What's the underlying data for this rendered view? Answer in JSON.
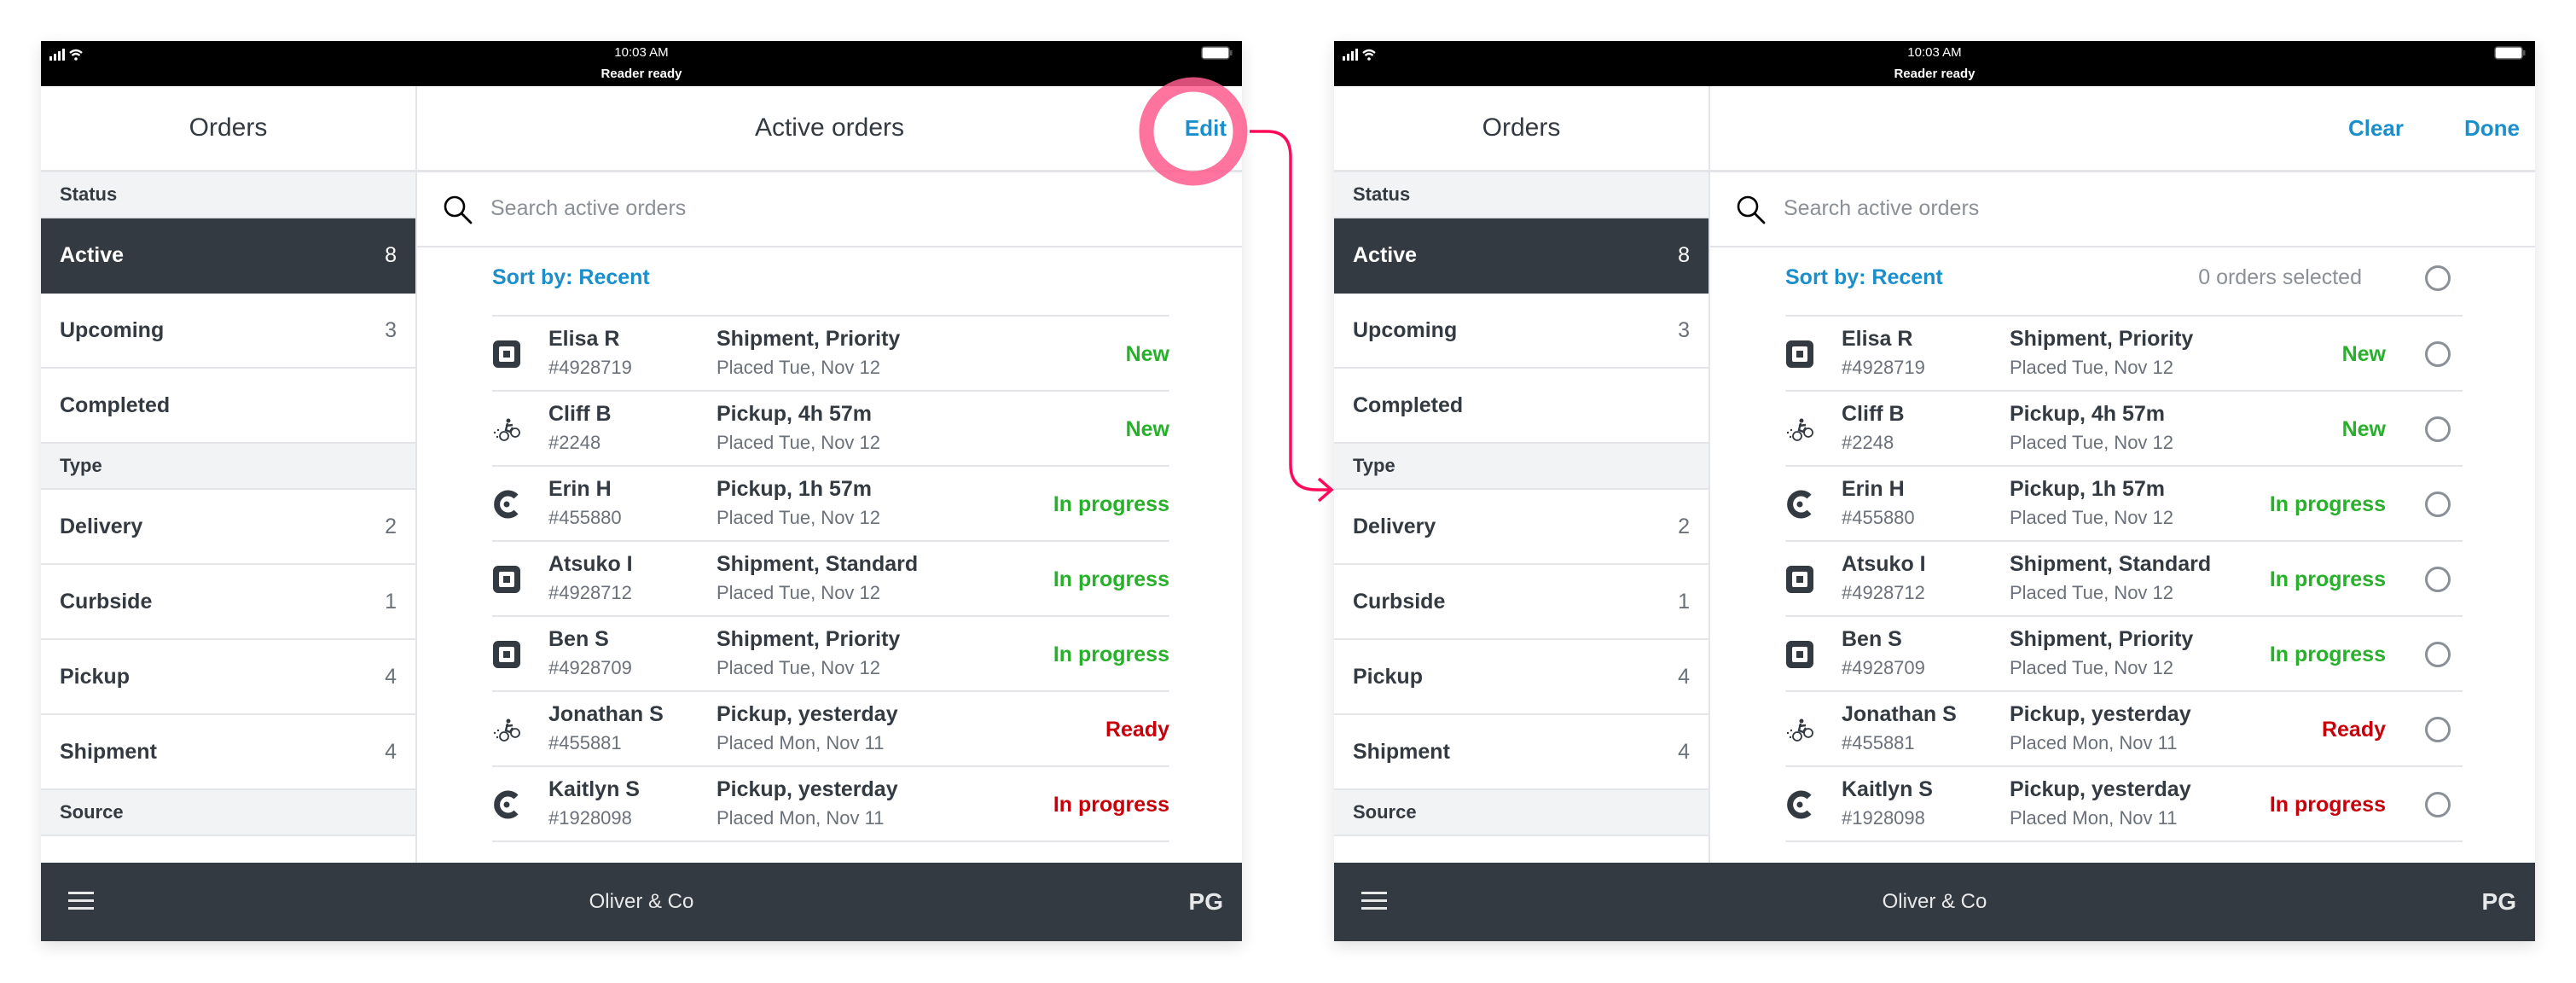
{
  "status_bar": {
    "time": "10:03 AM",
    "reader_status": "Reader ready"
  },
  "sidebar": {
    "title": "Orders",
    "sections": [
      {
        "header": "Status",
        "items": [
          {
            "label": "Active",
            "count": "8",
            "selected": true
          },
          {
            "label": "Upcoming",
            "count": "3",
            "selected": false
          },
          {
            "label": "Completed",
            "count": "",
            "selected": false
          }
        ]
      },
      {
        "header": "Type",
        "items": [
          {
            "label": "Delivery",
            "count": "2",
            "selected": false
          },
          {
            "label": "Curbside",
            "count": "1",
            "selected": false
          },
          {
            "label": "Pickup",
            "count": "4",
            "selected": false
          },
          {
            "label": "Shipment",
            "count": "4",
            "selected": false
          }
        ]
      },
      {
        "header": "Source",
        "items": []
      }
    ]
  },
  "left_screen": {
    "title": "Active orders",
    "edit_label": "Edit"
  },
  "right_screen": {
    "clear_label": "Clear",
    "done_label": "Done",
    "selected_count_text": "0 orders selected"
  },
  "search": {
    "placeholder": "Search active orders",
    "value": ""
  },
  "sort_label": "Sort by: Recent",
  "colors": {
    "accent": "#1a8fcc",
    "status_green": "#27b02a",
    "status_red": "#c8000a",
    "dark": "#343a41",
    "annotation_pink": "#ff0a5a"
  },
  "source_icons": {
    "square": "square-logo-icon",
    "courier": "courier-bike-icon",
    "caviar": "caviar-c-icon"
  },
  "orders": [
    {
      "source": "square",
      "name": "Elisa R",
      "number": "#4928719",
      "type": "Shipment, Priority",
      "placed": "Placed Tue, Nov 12",
      "status": "New",
      "status_color": "green"
    },
    {
      "source": "courier",
      "name": "Cliff B",
      "number": "#2248",
      "type": "Pickup, 4h 57m",
      "placed": "Placed Tue, Nov 12",
      "status": "New",
      "status_color": "green"
    },
    {
      "source": "caviar",
      "name": "Erin H",
      "number": "#455880",
      "type": "Pickup, 1h 57m",
      "placed": "Placed Tue, Nov 12",
      "status": "In progress",
      "status_color": "green"
    },
    {
      "source": "square",
      "name": "Atsuko I",
      "number": "#4928712",
      "type": "Shipment, Standard",
      "placed": "Placed Tue, Nov 12",
      "status": "In progress",
      "status_color": "green"
    },
    {
      "source": "square",
      "name": "Ben S",
      "number": "#4928709",
      "type": "Shipment, Priority",
      "placed": "Placed Tue, Nov 12",
      "status": "In progress",
      "status_color": "green"
    },
    {
      "source": "courier",
      "name": "Jonathan S",
      "number": "#455881",
      "type": "Pickup, yesterday",
      "placed": "Placed Mon, Nov 11",
      "status": "Ready",
      "status_color": "red"
    },
    {
      "source": "caviar",
      "name": "Kaitlyn S",
      "number": "#1928098",
      "type": "Pickup, yesterday",
      "placed": "Placed Mon, Nov 11",
      "status": "In progress",
      "status_color": "red"
    }
  ],
  "bottom_bar": {
    "business_name": "Oliver & Co",
    "user_initials": "PG"
  }
}
